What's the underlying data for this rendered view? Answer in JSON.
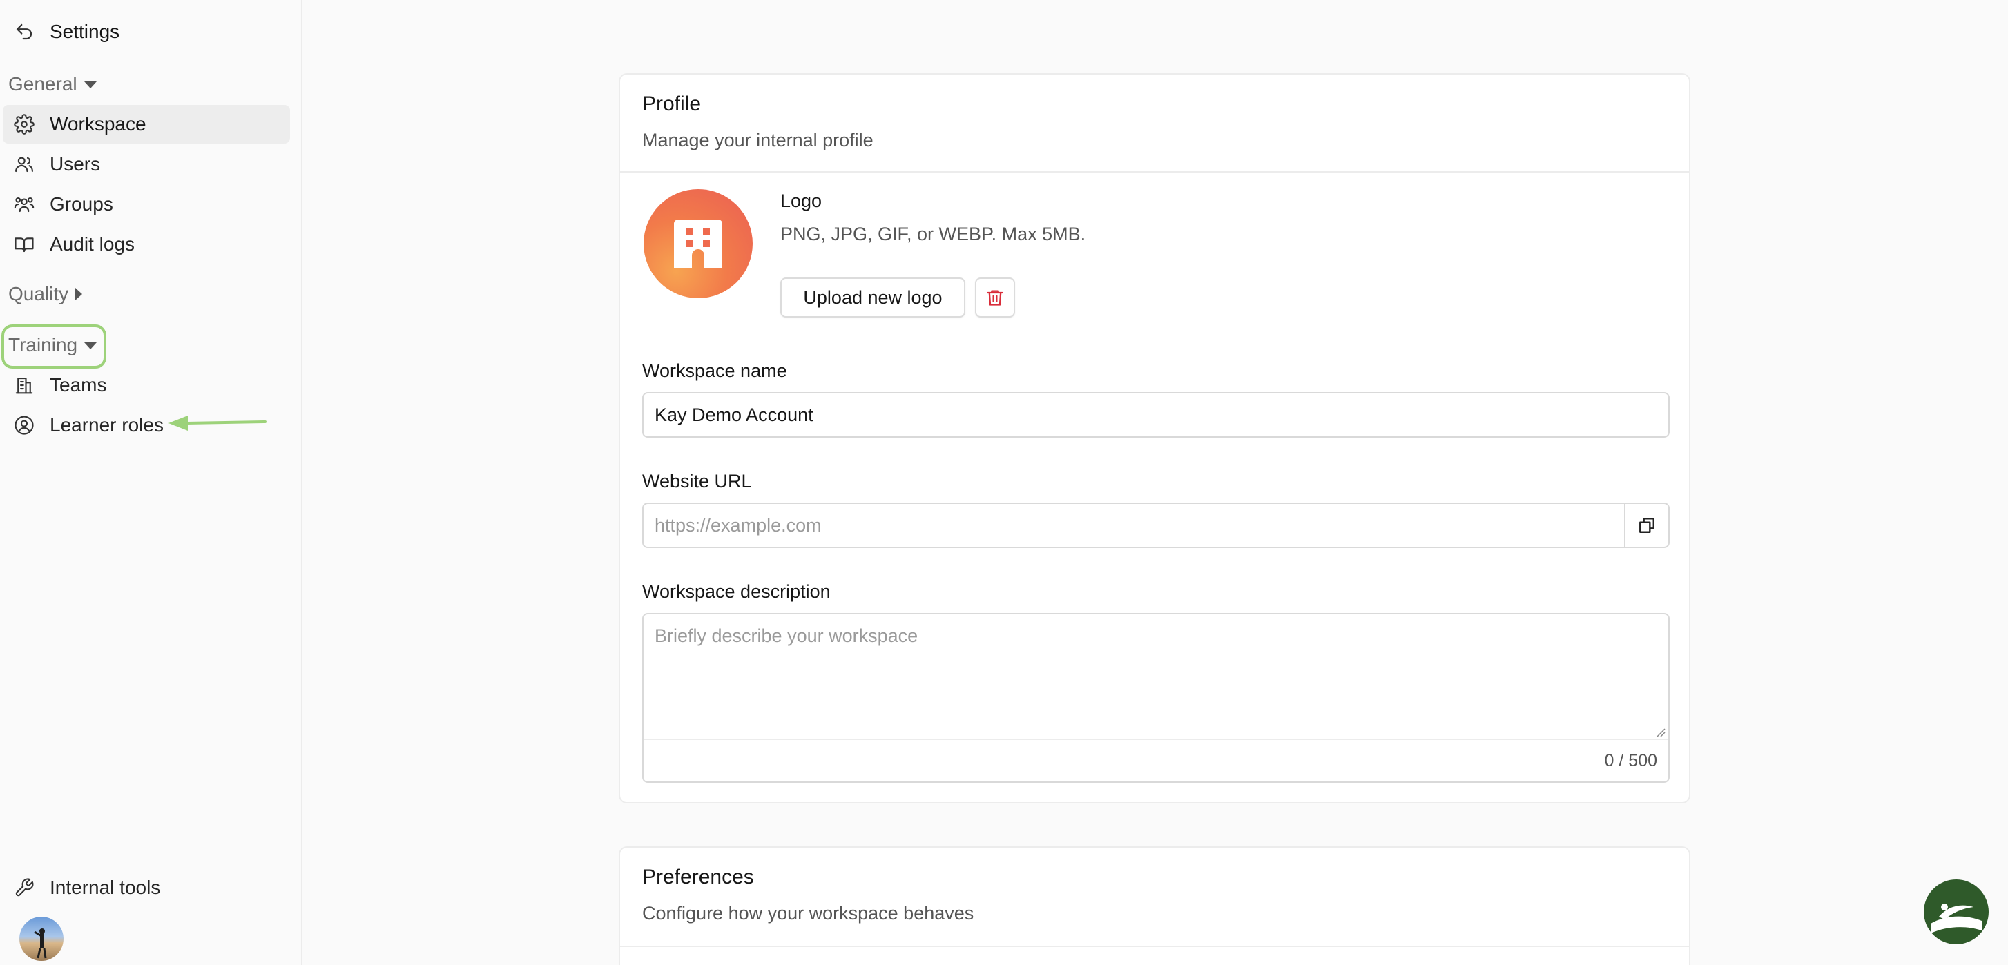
{
  "sidebar": {
    "header": {
      "title": "Settings"
    },
    "general": {
      "label": "General",
      "items": [
        {
          "label": "Workspace",
          "icon": "gear-icon",
          "active": true
        },
        {
          "label": "Users",
          "icon": "users-icon"
        },
        {
          "label": "Groups",
          "icon": "groups-icon"
        },
        {
          "label": "Audit logs",
          "icon": "book-icon"
        }
      ]
    },
    "quality": {
      "label": "Quality"
    },
    "training": {
      "label": "Training",
      "items": [
        {
          "label": "Teams",
          "icon": "building-icon"
        },
        {
          "label": "Learner roles",
          "icon": "user-circle-icon"
        }
      ]
    },
    "footer": {
      "internal_tools": "Internal tools"
    }
  },
  "profile": {
    "title": "Profile",
    "subtitle": "Manage your internal profile",
    "logo": {
      "label": "Logo",
      "helper": "PNG, JPG, GIF, or WEBP. Max 5MB.",
      "upload_label": "Upload new logo"
    },
    "workspace_name": {
      "label": "Workspace name",
      "value": "Kay Demo Account"
    },
    "website_url": {
      "label": "Website URL",
      "value": "",
      "placeholder": "https://example.com"
    },
    "description": {
      "label": "Workspace description",
      "value": "",
      "placeholder": "Briefly describe your workspace",
      "counter": "0 / 500"
    }
  },
  "preferences": {
    "title": "Preferences",
    "subtitle": "Configure how your workspace behaves"
  },
  "colors": {
    "annotation": "#9dd27a",
    "accent_logo": "#f27b4a",
    "danger": "#d92d3a"
  }
}
